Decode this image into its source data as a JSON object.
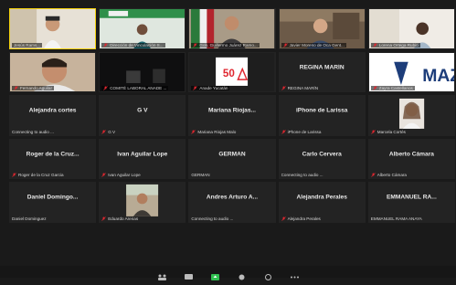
{
  "tiles": [
    {
      "label": "Jesús Rams...",
      "muted": false,
      "active": true,
      "video": "person-office-1"
    },
    {
      "label": "Dirección de Vinculación S...",
      "muted": true,
      "video": "person-banner"
    },
    {
      "label": "Gob. Guillermo Juárez Ramo...",
      "muted": true,
      "video": "person-flags"
    },
    {
      "label": "Javier Moreno de Oca Gent...",
      "muted": true,
      "video": "person-shelves"
    },
    {
      "label": "Lorena Ortega Rubio",
      "muted": true,
      "video": "person-light"
    },
    {
      "label": "Fernando Aguilar",
      "muted": true,
      "video": "person-close"
    },
    {
      "label": "COMITÉ LABORAL ANADE ...",
      "muted": true,
      "video": "dark-room"
    },
    {
      "label": "Anade Yucatán",
      "muted": true,
      "video": "anade-logo"
    },
    {
      "name": "REGINA MARÍN",
      "label": "REGINA MARÍN",
      "muted": true
    },
    {
      "label": "Zayra Castellanos",
      "muted": true,
      "video": "maz-logo"
    },
    {
      "name": "Alejandra cortes",
      "label": "Connecting to audio ...",
      "muted": false
    },
    {
      "name": "G V",
      "label": "G V",
      "muted": true
    },
    {
      "name": "Mariana Riojas...",
      "label": "Mariana Riojas Malo",
      "muted": true
    },
    {
      "name": "iPhone de Larissa",
      "label": "iPhone de Larissa",
      "muted": true
    },
    {
      "label": "Marcela Cortés",
      "muted": true,
      "video": "woman-photo"
    },
    {
      "name": "Roger de la Cruz...",
      "label": "Roger de la Cruz Garcia",
      "muted": true
    },
    {
      "name": "Ivan Aguilar Lope",
      "label": "Ivan Aguilar Lope",
      "muted": true
    },
    {
      "name": "GERMAN",
      "label": "GERMAN",
      "muted": false
    },
    {
      "name": "Carlo Cervera",
      "label": "Connecting to audio ...",
      "muted": false
    },
    {
      "name": "Alberto Cámara",
      "label": "Alberto Cámara",
      "muted": true
    },
    {
      "name": "Daniel Domingo...",
      "label": "Daniel Dominguez",
      "muted": false
    },
    {
      "label": "Eduardo Arenas",
      "muted": true,
      "video": "man-room"
    },
    {
      "name": "Andres Arturo A...",
      "label": "Connecting to audio ...",
      "muted": false
    },
    {
      "name": "Alejandra Perales",
      "label": "Alejandra Perales",
      "muted": true
    },
    {
      "name": "EMMANUEL RA...",
      "label": "EMMANUEL RAMA ANAYA",
      "muted": false
    }
  ],
  "colors": {
    "active_border": "#f5d20d",
    "muted_icon": "#e0262f",
    "background": "#1a1a1a",
    "tile": "#232323"
  }
}
